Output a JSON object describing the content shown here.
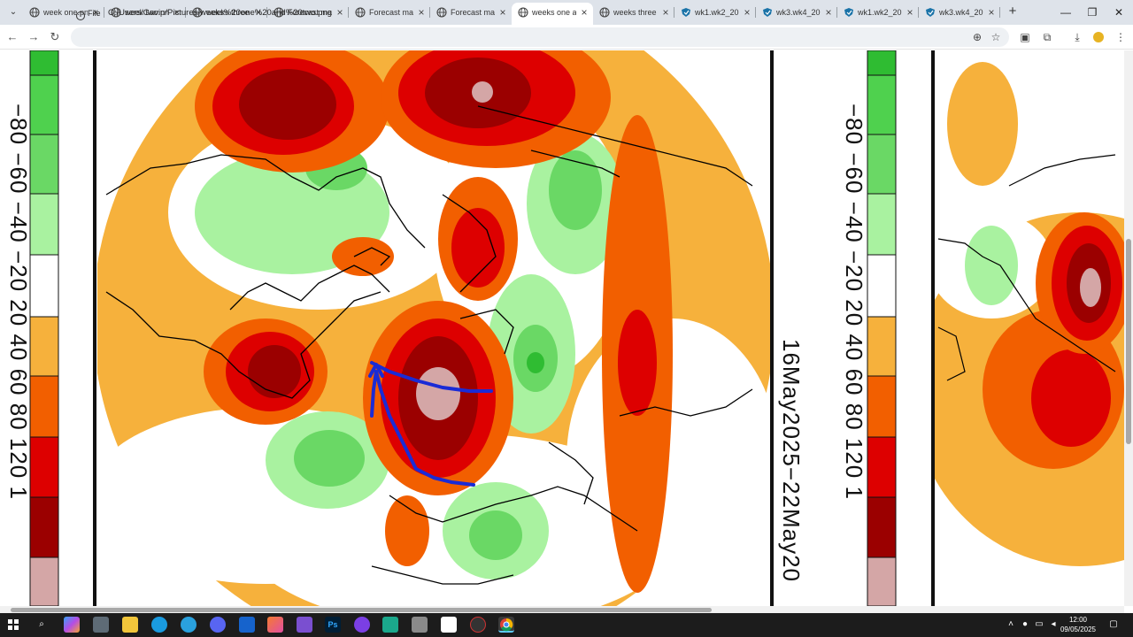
{
  "browser": {
    "tabs": [
      {
        "title": "week one.pn",
        "icon": "globe-icon"
      },
      {
        "title": "week two.pn",
        "icon": "globe-icon"
      },
      {
        "title": "weeks three",
        "icon": "globe-icon"
      },
      {
        "title": "Forecast ma",
        "icon": "globe-icon"
      },
      {
        "title": "Forecast ma",
        "icon": "globe-icon"
      },
      {
        "title": "Forecast ma",
        "icon": "globe-icon"
      },
      {
        "title": "weeks one a",
        "icon": "globe-icon",
        "active": true
      },
      {
        "title": "weeks three",
        "icon": "globe-icon"
      },
      {
        "title": "wk1.wk2_20",
        "icon": "shield-icon"
      },
      {
        "title": "wk3.wk4_20",
        "icon": "shield-icon"
      },
      {
        "title": "wk1.wk2_20",
        "icon": "shield-icon"
      },
      {
        "title": "wk3.wk4_20",
        "icon": "shield-icon"
      }
    ],
    "site_info_label": "File",
    "url": "C:/Users/Gavin/Pictures/weeks%20one%20and%20two.png",
    "toolbar_icons": [
      "zoom-icon",
      "bookmark-star-icon",
      "screenshot-icon",
      "extensions-icon",
      "download-icon",
      "profile-icon",
      "menu-icon"
    ]
  },
  "page": {
    "left_scale": "−80 −60 −40 −20 20 40 60 80 120 1",
    "date_label": "16May2025−22May20",
    "right_scale": "−80 −60 −40 −20 20 40 60 80 120 1",
    "colors": {
      "dark_red": "#9b0000",
      "red": "#dd0000",
      "orange": "#f25f00",
      "light_orange": "#f6b13c",
      "light_green": "#a9f2a0",
      "green": "#6ad865",
      "dark_green": "#2fbc32",
      "pink": "#d4a6a6",
      "annotation_blue": "#1a2bd6"
    }
  },
  "taskbar": {
    "apps": [
      "start-icon",
      "search-icon",
      "copilot-icon",
      "explorer-icon",
      "files-icon",
      "edge-icon",
      "telegram-icon",
      "discord-icon",
      "malwarebytes-icon",
      "photos-icon",
      "app-icon",
      "photoshop-icon",
      "obs-icon",
      "app-icon",
      "app-icon",
      "app-icon",
      "app-icon",
      "chrome-icon"
    ],
    "photoshop_label": "Ps",
    "time": "12:00",
    "date": "09/05/2025"
  }
}
